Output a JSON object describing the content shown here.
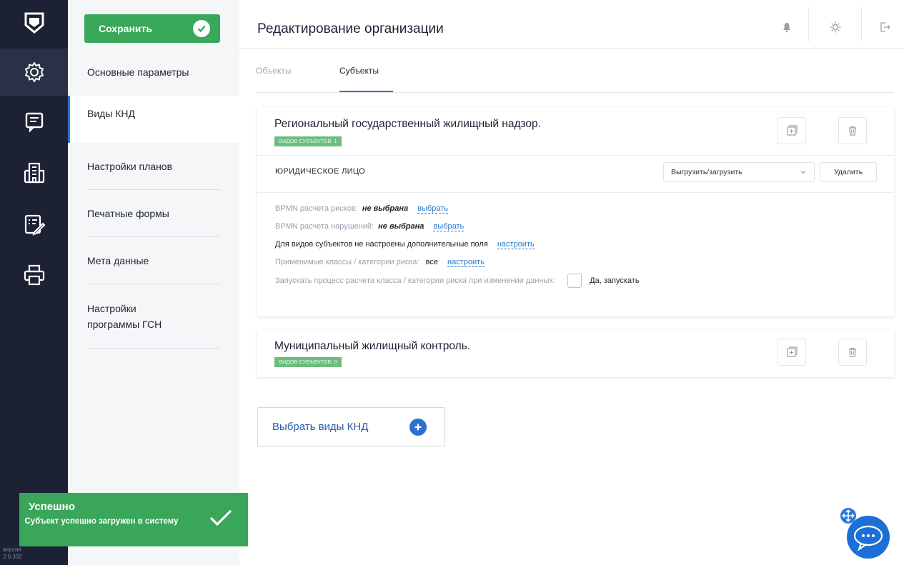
{
  "header": {
    "title": "Редактирование организации"
  },
  "sidebar": {
    "save_label": "Сохранить",
    "items": [
      {
        "label": "Основные параметры"
      },
      {
        "label": "Виды КНД"
      },
      {
        "label": "Настройки планов"
      },
      {
        "label": "Печатные формы"
      },
      {
        "label": "Мета данные"
      },
      {
        "label": "Настройки программы ГСН"
      }
    ],
    "active_index": 1
  },
  "rail": {
    "icons": [
      "logo-icon",
      "settings-icon",
      "document-icon",
      "building-icon",
      "edit-list-icon",
      "printer-icon"
    ],
    "version_label": "версия",
    "version": "2.0.332"
  },
  "tabs": [
    {
      "label": "Объекты",
      "active": false
    },
    {
      "label": "Субъекты",
      "active": true
    }
  ],
  "cards": [
    {
      "title": "Региональный государственный жилищный надзор.",
      "badge": "ВИДОВ СУБЪЕКТОВ: 1",
      "entity": {
        "label": "ЮРИДИЧЕСКОЕ ЛИЦО",
        "dropdown_value": "Выгрузить/загрузить",
        "delete_label": "Удалить",
        "lines": {
          "bpmn_risk_label": "BPMN расчета рисков:",
          "bpmn_risk_value": "не выбрана",
          "bpmn_risk_link": "выбрать",
          "bpmn_violation_label": "BPMN расчета нарушений:",
          "bpmn_violation_value": "не выбрана",
          "bpmn_violation_link": "выбрать",
          "fields_text": "Для видов субъектов не настроены дополнительные поля",
          "fields_link": "настроить",
          "classes_label": "Применимые классы / категории риска:",
          "classes_value": "все",
          "classes_link": "настроить",
          "run_label": "Запускать процесс расчета класса / категории риска при изменении данных:",
          "run_option": "Да, запускать"
        }
      }
    },
    {
      "title": "Муниципальный жилищный контроль.",
      "badge": "ВИДОВ СУБЪЕКТОВ: 0"
    }
  ],
  "select_button": {
    "label": "Выбрать виды КНД"
  },
  "toast": {
    "title": "Успешно",
    "message": "Субъект успешно загружен в систему"
  },
  "colors": {
    "rail_bg": "#1c2233",
    "success": "#3aa65a",
    "accent": "#2979c9"
  }
}
